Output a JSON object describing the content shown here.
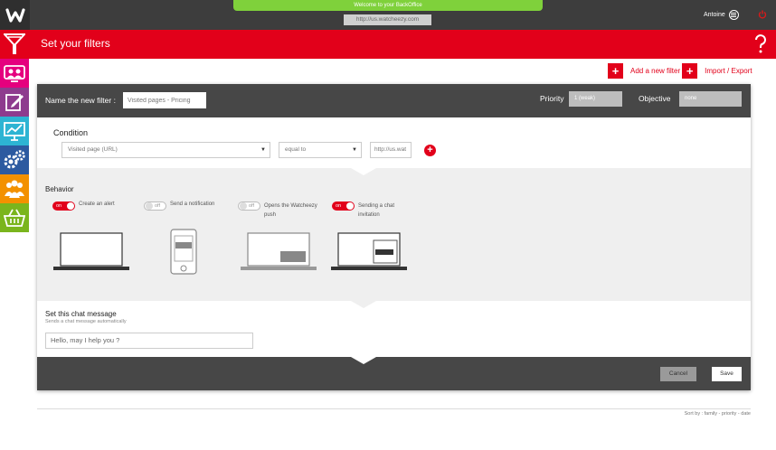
{
  "topbar": {
    "welcome": "Welcome to your BackOffice",
    "url": "http://us.watcheezy.com",
    "user": "Antoine"
  },
  "header": {
    "title": "Set your filters"
  },
  "sidebar": {
    "icons": [
      "filter-icon",
      "chat-monitor-icon",
      "edit-icon",
      "stats-icon",
      "settings-icon",
      "users-icon",
      "basket-icon"
    ],
    "colors": [
      "#e2001a",
      "#e5007e",
      "#8e3b8e",
      "#2db4d3",
      "#2c5aa0",
      "#f39100",
      "#7ab51d"
    ]
  },
  "actions": {
    "add_filter": "Add a new filter",
    "import_export": "Import / Export"
  },
  "filter": {
    "name_label": "Name the new filter :",
    "name_value": "Visited pages - Pricing",
    "priority_label": "Priority",
    "priority_value": "1 (weak)",
    "objective_label": "Objective",
    "objective_value": "none"
  },
  "condition": {
    "title": "Condition",
    "field": "Visited page (URL)",
    "operator": "equal to",
    "value": "http://us.wat"
  },
  "behavior": {
    "title": "Behavior",
    "options": [
      {
        "state": "on",
        "label": "Create an alert"
      },
      {
        "state": "off",
        "label": "Send a notification"
      },
      {
        "state": "off",
        "label": "Opens the Watcheezy push"
      },
      {
        "state": "on",
        "label": "Sending a chat invitation"
      }
    ]
  },
  "chat": {
    "title": "Set this chat message",
    "subtitle": "Sends a chat message automatically",
    "message": "Hello, may I help you ?"
  },
  "footer": {
    "cancel": "Cancel",
    "save": "Save"
  },
  "sort": "Sort by : family - priority - date"
}
